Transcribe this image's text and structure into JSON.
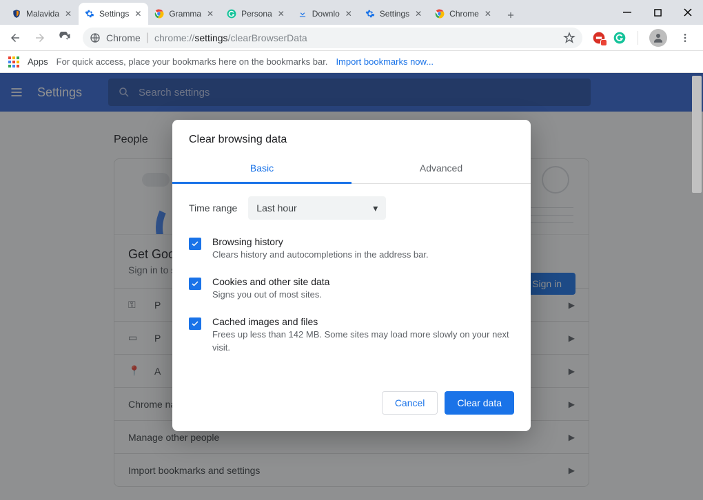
{
  "tabs": [
    {
      "title": "Malavida",
      "favicon": "shield-orange"
    },
    {
      "title": "Settings",
      "favicon": "gear-blue",
      "active": true
    },
    {
      "title": "Gramma",
      "favicon": "chrome"
    },
    {
      "title": "Persona",
      "favicon": "grammarly"
    },
    {
      "title": "Downlo",
      "favicon": "download-blue"
    },
    {
      "title": "Settings",
      "favicon": "gear-blue"
    },
    {
      "title": "Chrome",
      "favicon": "chrome"
    }
  ],
  "omnibox": {
    "prefix_label": "Chrome",
    "url_faded": "chrome://",
    "url_bold": "settings",
    "url_rest": "/clearBrowserData"
  },
  "bookmarks": {
    "apps_label": "Apps",
    "hint": "For quick access, place your bookmarks here on the bookmarks bar.",
    "import_link": "Import bookmarks now..."
  },
  "settings_header": {
    "title": "Settings",
    "search_placeholder": "Search settings"
  },
  "page": {
    "section": "People",
    "promo_title": "Get Goo",
    "promo_sub": "Sign in to s",
    "signin_btn": "Sign in",
    "rows": [
      {
        "icon": "key",
        "label": "P"
      },
      {
        "icon": "card",
        "label": "P"
      },
      {
        "icon": "pin",
        "label": "A"
      },
      {
        "icon": "",
        "label": "Chrome na"
      },
      {
        "icon": "",
        "label": "Manage other people"
      },
      {
        "icon": "",
        "label": "Import bookmarks and settings"
      }
    ]
  },
  "dialog": {
    "title": "Clear browsing data",
    "tabs": {
      "basic": "Basic",
      "advanced": "Advanced"
    },
    "time_range_label": "Time range",
    "time_range_value": "Last hour",
    "options": [
      {
        "title": "Browsing history",
        "desc": "Clears history and autocompletions in the address bar.",
        "checked": true
      },
      {
        "title": "Cookies and other site data",
        "desc": "Signs you out of most sites.",
        "checked": true
      },
      {
        "title": "Cached images and files",
        "desc": "Frees up less than 142 MB. Some sites may load more slowly on your next visit.",
        "checked": true
      }
    ],
    "cancel": "Cancel",
    "confirm": "Clear data"
  }
}
